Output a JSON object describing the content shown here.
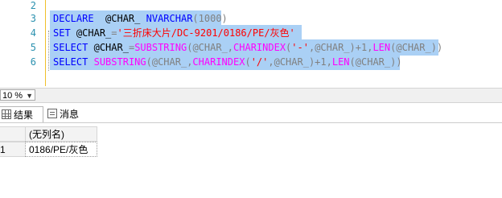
{
  "editor": {
    "line_numbers": [
      "2",
      "3",
      "4",
      "5",
      "6"
    ],
    "lines": [
      {
        "kw1": "DECLARE",
        "sp1": "  ",
        "var1": "@CHAR_",
        "sp2": " ",
        "kw2": "NVARCHAR",
        "rest": "(1000)"
      },
      {
        "kw1": "SET",
        "sp1": " ",
        "var1": "@CHAR_",
        "eq": "=",
        "str": "'三折床大片/DC-9201/0186/PE/灰色'"
      },
      {
        "kw1": "SELECT",
        "sp1": " ",
        "var1": "@CHAR_",
        "eq": "=",
        "fn1": "SUBSTRING",
        "p1": "(@CHAR_,",
        "fn2": "CHARINDEX",
        "p2": "(",
        "str": "'-'",
        "p3": ",@CHAR_)+1,",
        "fn3": "LEN",
        "p4": "(@CHAR_))"
      },
      {
        "kw1": "SELECT",
        "sp1": " ",
        "fn1": "SUBSTRING",
        "p1": "(@CHAR_,",
        "fn2": "CHARINDEX",
        "p2": "(",
        "str": "'/'",
        "p3": ",@CHAR_)+1,",
        "fn3": "LEN",
        "p4": "(@CHAR_))"
      }
    ]
  },
  "zoom": {
    "value": "10 %"
  },
  "tabs": [
    {
      "label": "结果",
      "icon": "grid-icon"
    },
    {
      "label": "消息",
      "icon": "message-icon"
    }
  ],
  "results": {
    "column_header": "(无列名)",
    "rows": [
      {
        "num": "1",
        "value": "0186/PE/灰色"
      }
    ]
  }
}
